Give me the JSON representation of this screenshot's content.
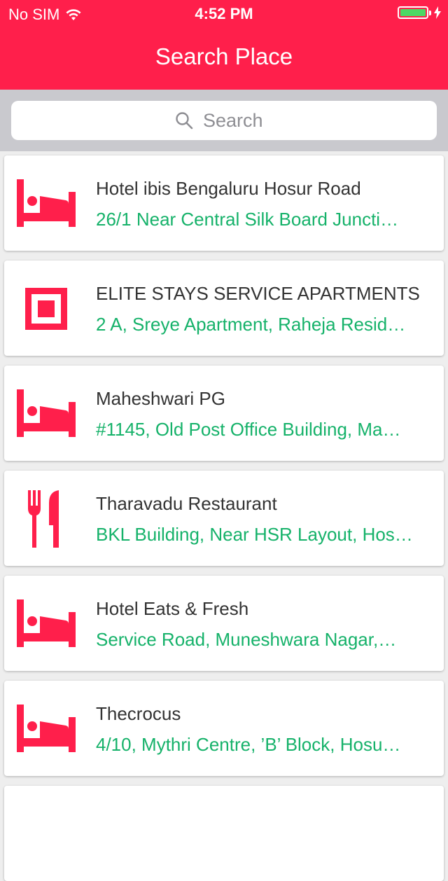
{
  "status_bar": {
    "carrier": "No SIM",
    "time": "4:52 PM",
    "battery_color": "#4cd964"
  },
  "header": {
    "title": "Search Place",
    "color": "#ff1f4b"
  },
  "search": {
    "placeholder": "Search",
    "value": ""
  },
  "places": [
    {
      "icon": "bed-icon",
      "name": "Hotel ibis Bengaluru Hosur Road",
      "address": "26/1 Near Central Silk Board Juncti…"
    },
    {
      "icon": "square-icon",
      "name": "ELITE STAYS SERVICE APARTMENTS",
      "address": "2 A, Sreye Apartment, Raheja Resid…"
    },
    {
      "icon": "bed-icon",
      "name": "Maheshwari PG",
      "address": "#1145, Old Post Office Building, Ma…"
    },
    {
      "icon": "restaurant-icon",
      "name": "Tharavadu Restaurant",
      "address": "BKL Building, Near HSR Layout, Hos…"
    },
    {
      "icon": "bed-icon",
      "name": "Hotel Eats & Fresh",
      "address": "Service Road, Muneshwara Nagar,…"
    },
    {
      "icon": "bed-icon",
      "name": "Thecrocus",
      "address": "4/10, Mythri Centre, ’B’ Block, Hosu…"
    }
  ],
  "colors": {
    "accent": "#ff1f4b",
    "address": "#16b26a",
    "name": "#333333"
  }
}
